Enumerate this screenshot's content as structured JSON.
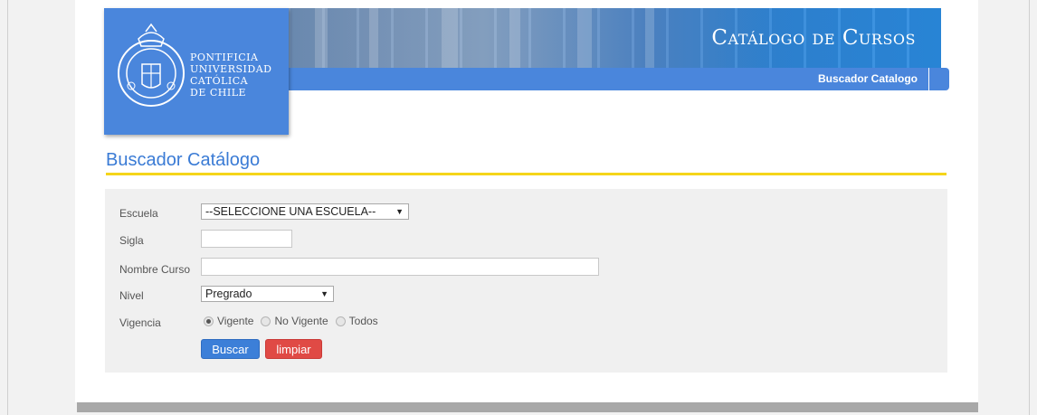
{
  "header": {
    "institution_lines": [
      "PONTIFICIA",
      "UNIVERSIDAD",
      "CATÓLICA",
      "DE CHILE"
    ],
    "banner_title": "Catálogo de Cursos",
    "nav_item": "Buscador Catalogo"
  },
  "page_title": "Buscador Catálogo",
  "form": {
    "escuela": {
      "label": "Escuela",
      "selected": "--SELECCIONE UNA ESCUELA--"
    },
    "sigla": {
      "label": "Sigla",
      "value": ""
    },
    "nombre_curso": {
      "label": "Nombre Curso",
      "value": ""
    },
    "nivel": {
      "label": "Nivel",
      "selected": "Pregrado"
    },
    "vigencia": {
      "label": "Vigencia",
      "options": [
        "Vigente",
        "No Vigente",
        "Todos"
      ],
      "selected": "Vigente"
    },
    "buscar_label": "Buscar",
    "limpiar_label": "limpiar"
  },
  "colors": {
    "primary": "#4a86dc",
    "accent": "#f5d51a",
    "danger": "#e04a45"
  }
}
